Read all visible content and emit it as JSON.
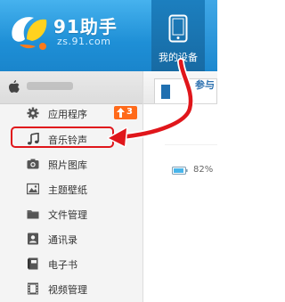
{
  "app": {
    "title": "91助手",
    "url": "zs.91.com"
  },
  "header": {
    "nav_tab_label": "我的设备"
  },
  "sidebar": {
    "items": [
      {
        "label": "应用程序",
        "icon": "gear-icon",
        "badge": "3"
      },
      {
        "label": "音乐铃声",
        "icon": "music-note-icon"
      },
      {
        "label": "照片图库",
        "icon": "camera-icon"
      },
      {
        "label": "主题壁纸",
        "icon": "picture-icon"
      },
      {
        "label": "文件管理",
        "icon": "folder-icon"
      },
      {
        "label": "通讯录",
        "icon": "contacts-icon"
      },
      {
        "label": "电子书",
        "icon": "book-icon"
      },
      {
        "label": "视频管理",
        "icon": "film-icon"
      }
    ]
  },
  "main": {
    "tab_label": "参与",
    "battery": "82%"
  },
  "colors": {
    "header_blue": "#1e8fd6",
    "annotation_red": "#e0161b",
    "badge_orange": "#ff6a1a"
  }
}
